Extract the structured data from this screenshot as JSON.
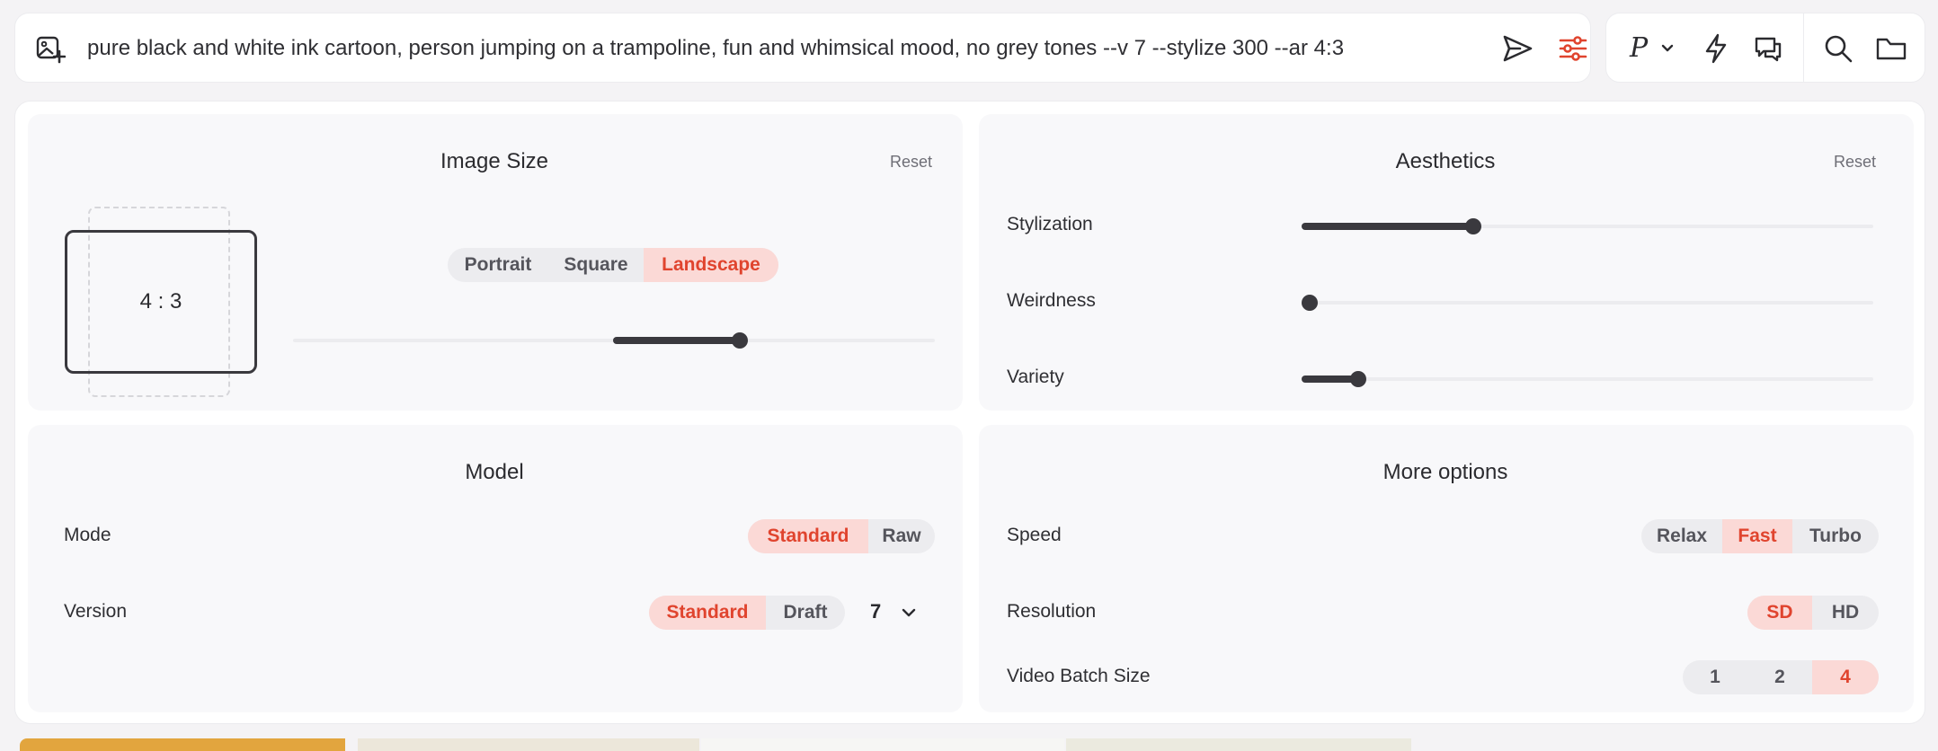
{
  "prompt_bar": {
    "text": "pure black and white ink cartoon, person jumping on a trampoline, fun and whimsical mood, no grey tones --v 7 --stylize 300 --ar 4:3",
    "add_image_icon": "image-plus-icon",
    "send_icon": "send-icon",
    "settings_icon": "sliders-icon"
  },
  "toolbar": {
    "personalize_label": "P",
    "icons": [
      "chevron-down-icon",
      "bolt-icon",
      "chat-icon",
      "search-icon",
      "folder-icon"
    ]
  },
  "image_size": {
    "title": "Image Size",
    "reset": "Reset",
    "ratio": "4 : 3",
    "orientations": [
      "Portrait",
      "Square",
      "Landscape"
    ],
    "selected_orientation": "Landscape"
  },
  "aesthetics": {
    "title": "Aesthetics",
    "reset": "Reset",
    "stylization_label": "Stylization",
    "weirdness_label": "Weirdness",
    "variety_label": "Variety"
  },
  "model": {
    "title": "Model",
    "mode_label": "Mode",
    "mode_options": [
      "Standard",
      "Raw"
    ],
    "mode_selected": "Standard",
    "version_label": "Version",
    "version_options": [
      "Standard",
      "Draft"
    ],
    "version_selected": "Standard",
    "version_number": "7"
  },
  "more_options": {
    "title": "More options",
    "speed_label": "Speed",
    "speed_options": [
      "Relax",
      "Fast",
      "Turbo"
    ],
    "speed_selected": "Fast",
    "resolution_label": "Resolution",
    "resolution_options": [
      "SD",
      "HD"
    ],
    "resolution_selected": "SD",
    "batch_label": "Video Batch Size",
    "batch_options": [
      "1",
      "2",
      "4"
    ],
    "batch_selected": "4"
  },
  "colors": {
    "accent": "#e0442e",
    "accent_bg": "#fbd9d6",
    "dark": "#3a393e"
  }
}
